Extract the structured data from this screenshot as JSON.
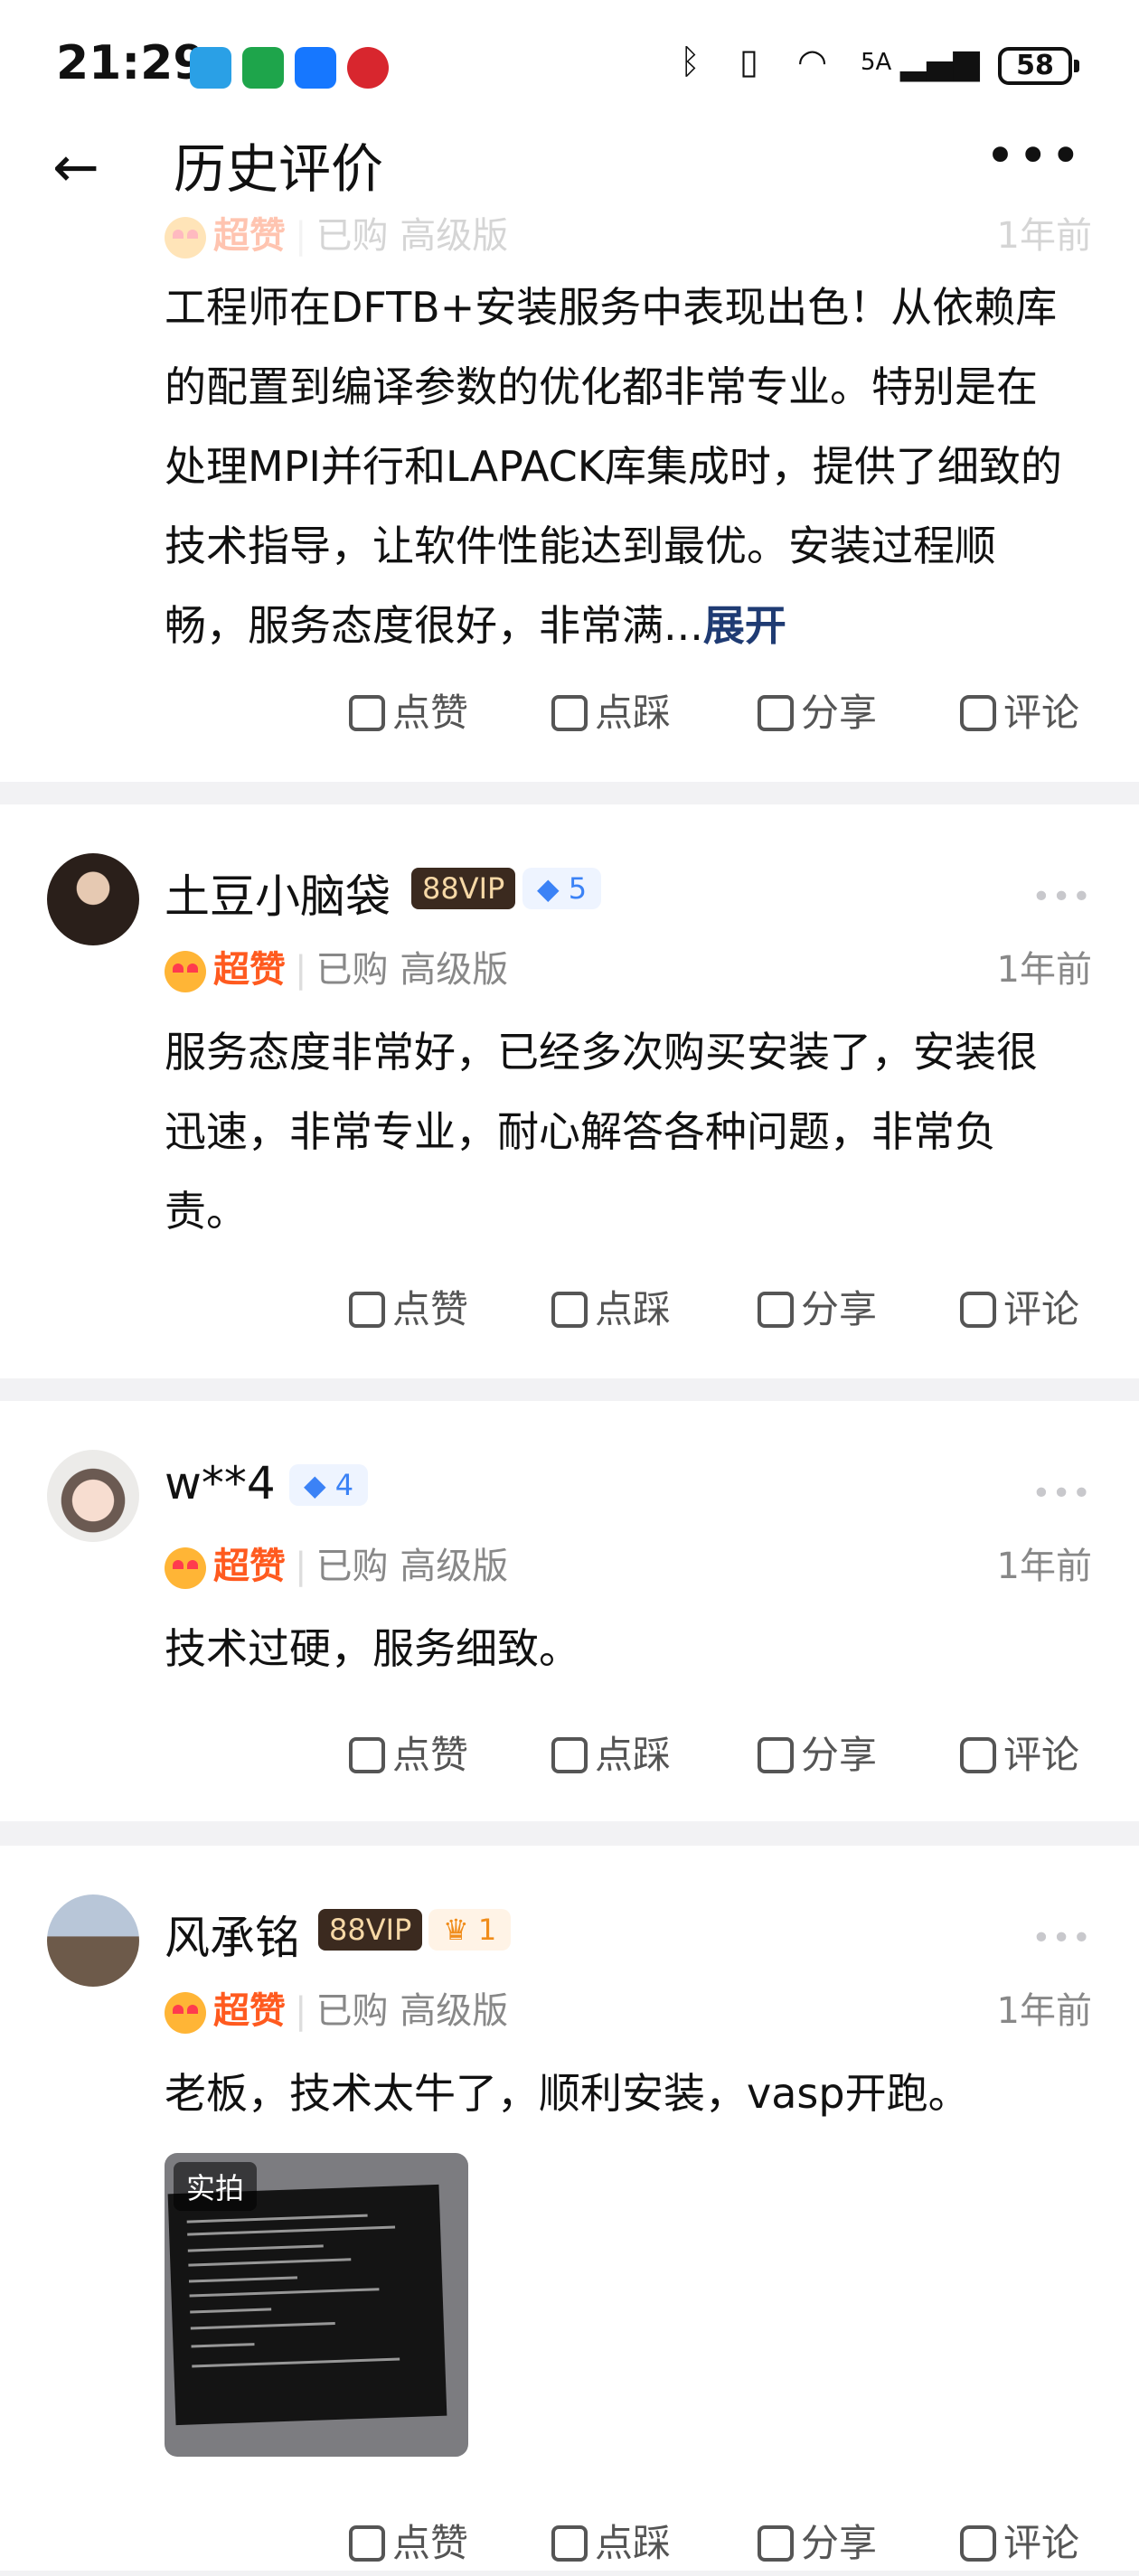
{
  "status": {
    "time": "21:29",
    "network": "5A",
    "battery": "58"
  },
  "header": {
    "title": "历史评价",
    "back_icon": "arrow-left-icon",
    "more_icon": "more-icon"
  },
  "actions": {
    "like": "点赞",
    "dislike": "点踩",
    "share": "分享",
    "comment": "评论"
  },
  "reviews": [
    {
      "rating": "超赞",
      "meta": "已购 高级版",
      "time": "1年前",
      "text": "工程师在DFTB+安装服务中表现出色！从依赖库的配置到编译参数的优化都非常专业。特别是在处理MPI并行和LAPACK库集成时，提供了细致的技术指导，让软件性能达到最优。安装过程顺畅，服务态度很好，非常满...",
      "expand": "展开"
    },
    {
      "name": "土豆小脑袋",
      "vip": "88VIP",
      "level": "5",
      "rating": "超赞",
      "meta": "已购 高级版",
      "time": "1年前",
      "text": "服务态度非常好，已经多次购买安装了，安装很迅速，非常专业，耐心解答各种问题，非常负责。"
    },
    {
      "name": "w**4",
      "level": "4",
      "rating": "超赞",
      "meta": "已购 高级版",
      "time": "1年前",
      "text": "技术过硬，服务细致。"
    },
    {
      "name": "风承铭",
      "vip": "88VIP",
      "level": "1",
      "rating": "超赞",
      "meta": "已购 高级版",
      "time": "1年前",
      "text": "老板，技术太牛了，顺利安装，vasp开跑。",
      "photo_tag": "实拍"
    }
  ]
}
